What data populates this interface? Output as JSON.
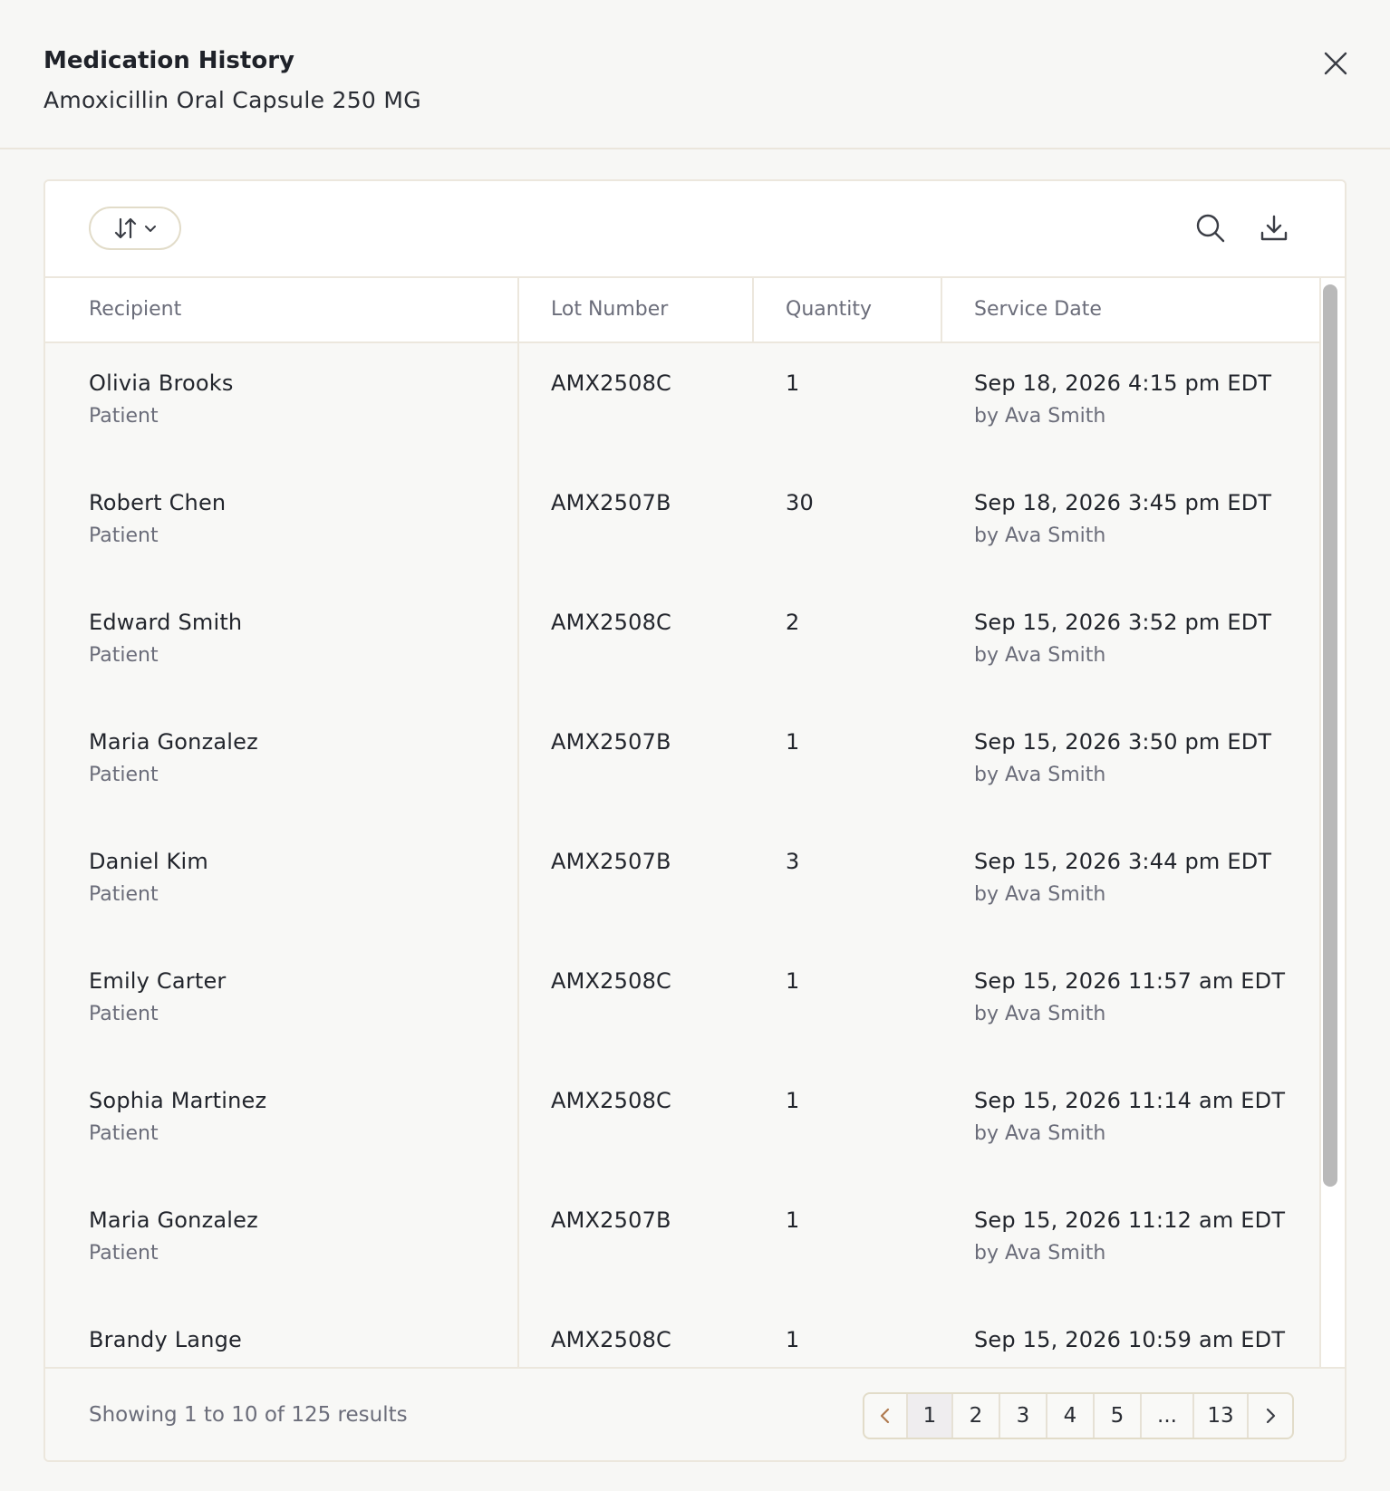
{
  "header": {
    "title": "Medication History",
    "subtitle": "Amoxicillin Oral Capsule 250 MG"
  },
  "table": {
    "columns": [
      "Recipient",
      "Lot Number",
      "Quantity",
      "Service Date"
    ],
    "rows": [
      {
        "recipient": "Olivia Brooks",
        "role": "Patient",
        "lot": "AMX2508C",
        "qty": "1",
        "date": "Sep 18, 2026 4:15 pm EDT",
        "by": "by Ava Smith"
      },
      {
        "recipient": "Robert Chen",
        "role": "Patient",
        "lot": "AMX2507B",
        "qty": "30",
        "date": "Sep 18, 2026 3:45 pm EDT",
        "by": "by Ava Smith"
      },
      {
        "recipient": "Edward Smith",
        "role": "Patient",
        "lot": "AMX2508C",
        "qty": "2",
        "date": "Sep 15, 2026 3:52 pm EDT",
        "by": "by Ava Smith"
      },
      {
        "recipient": "Maria Gonzalez",
        "role": "Patient",
        "lot": "AMX2507B",
        "qty": "1",
        "date": "Sep 15, 2026 3:50 pm EDT",
        "by": "by Ava Smith"
      },
      {
        "recipient": "Daniel Kim",
        "role": "Patient",
        "lot": "AMX2507B",
        "qty": "3",
        "date": "Sep 15, 2026 3:44 pm EDT",
        "by": "by Ava Smith"
      },
      {
        "recipient": "Emily Carter",
        "role": "Patient",
        "lot": "AMX2508C",
        "qty": "1",
        "date": "Sep 15, 2026 11:57 am EDT",
        "by": "by Ava Smith"
      },
      {
        "recipient": "Sophia Martinez",
        "role": "Patient",
        "lot": "AMX2508C",
        "qty": "1",
        "date": "Sep 15, 2026 11:14 am EDT",
        "by": "by Ava Smith"
      },
      {
        "recipient": "Maria Gonzalez",
        "role": "Patient",
        "lot": "AMX2507B",
        "qty": "1",
        "date": "Sep 15, 2026 11:12 am EDT",
        "by": "by Ava Smith"
      },
      {
        "recipient": "Brandy Lange",
        "role": "",
        "lot": "AMX2508C",
        "qty": "1",
        "date": "Sep 15, 2026 10:59 am EDT",
        "by": ""
      }
    ]
  },
  "footer": {
    "results_text": "Showing 1 to 10 of 125 results",
    "pages": [
      "1",
      "2",
      "3",
      "4",
      "5",
      "...",
      "13"
    ],
    "active_page": "1"
  },
  "icons": {
    "close": "close-icon",
    "sort": "sort-icon",
    "search": "search-icon",
    "download": "download-icon",
    "prev": "chevron-left-icon",
    "next": "chevron-right-icon"
  },
  "colors": {
    "accent_chevron": "#b07a4f",
    "border": "#ece7dd",
    "muted_text": "#6b6d7a"
  }
}
